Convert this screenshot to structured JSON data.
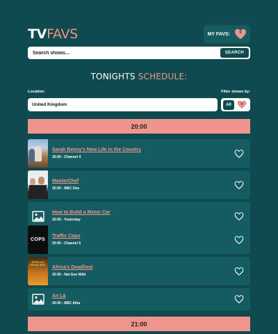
{
  "header": {
    "logo_tv": "TV",
    "logo_favs": "FAVS",
    "myfavs_label": "MY FAVS:",
    "myfavs_count": "0"
  },
  "search": {
    "placeholder": "Search shows...",
    "button_label": "SEARCH"
  },
  "schedule": {
    "title_part1": "TONIGHTS ",
    "title_part2": "SCHEDULE:",
    "location_label": "Location:",
    "location_value": "United Kingdom",
    "filter_label": "Filter shows by:",
    "filter_all": "All",
    "filter_favs_count": "0"
  },
  "slots": [
    {
      "time": "20:00",
      "shows": [
        {
          "title": "Sarah Beeny's New Life in the Country",
          "meta": "20:00 - Channel 4",
          "thumb": "photo-countryside"
        },
        {
          "title": "MasterChef",
          "meta": "20:00 - BBC One",
          "thumb": "photo-masterchef"
        },
        {
          "title": "How to Build a Motor Car",
          "meta": "20:00 - Yesterday",
          "thumb": "image-placeholder-icon"
        },
        {
          "title": "Traffic Cops",
          "meta": "20:00 - Channel 5",
          "thumb": "photo-cops"
        },
        {
          "title": "Africa's Deadliest",
          "meta": "20:00 - Nat Geo Wild",
          "thumb": "photo-africa"
        },
        {
          "title": "An Là",
          "meta": "20:00 - BBC Alba",
          "thumb": "image-placeholder-icon"
        }
      ]
    },
    {
      "time": "21:00",
      "shows": []
    }
  ],
  "thumb_text": {
    "cops": "COPS",
    "africa": "AFRICA'S DEADLIEST"
  },
  "colors": {
    "background": "#0e4a4e",
    "card": "#145c61",
    "accent": "#f0958e",
    "white": "#ffffff"
  }
}
